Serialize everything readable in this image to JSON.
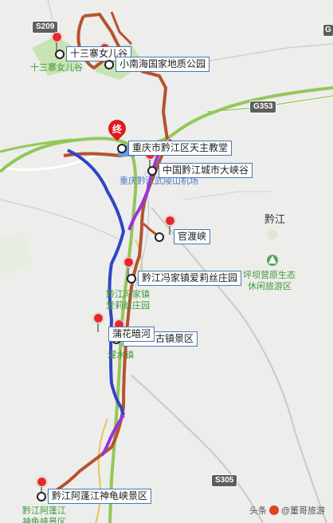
{
  "road_shields": [
    "S209",
    "G353",
    "S305"
  ],
  "corner_badge": "G",
  "pois": [
    {
      "id": "shisanzhai",
      "label": "十三寨女儿谷"
    },
    {
      "id": "xiaonanhai",
      "label": "小南海国家地质公园"
    },
    {
      "id": "church",
      "label": "重庆市黔江区天主教堂"
    },
    {
      "id": "canyon",
      "label": "中国黔江城市大峡谷"
    },
    {
      "id": "guandu",
      "label": "官渡峡"
    },
    {
      "id": "fengjia",
      "label": "黔江冯家镇爱莉丝庄园"
    },
    {
      "id": "puhua",
      "label": "蒲花暗河"
    },
    {
      "id": "guzhen",
      "label": "古镇景区"
    },
    {
      "id": "apeng",
      "label": "黔江阿蓬江神龟峡景区"
    }
  ],
  "map_labels": {
    "shisanzhai_green": "十三寨女儿谷",
    "airport": "重庆黔江武陵山机场",
    "qianjiang": "黔江",
    "pingba1": "坪坝营原生态",
    "pingba2": "休闲旅游区",
    "fengjia1": "黔江冯家镇",
    "fengjia2": "爱莉丝庄园",
    "puhua_green": "濯水镇",
    "apeng1": "黔江阿蓬江",
    "apeng2": "神龟峡景区"
  },
  "end_marker": "终",
  "watermark": {
    "prefix": "头条",
    "account": "@董哥旅游"
  },
  "colors": {
    "route_brown": "#b5532e",
    "route_blue": "#3344c4",
    "route_purple": "#9a33d4",
    "road_green": "#93c75a",
    "marker_red": "#e32a2a"
  }
}
